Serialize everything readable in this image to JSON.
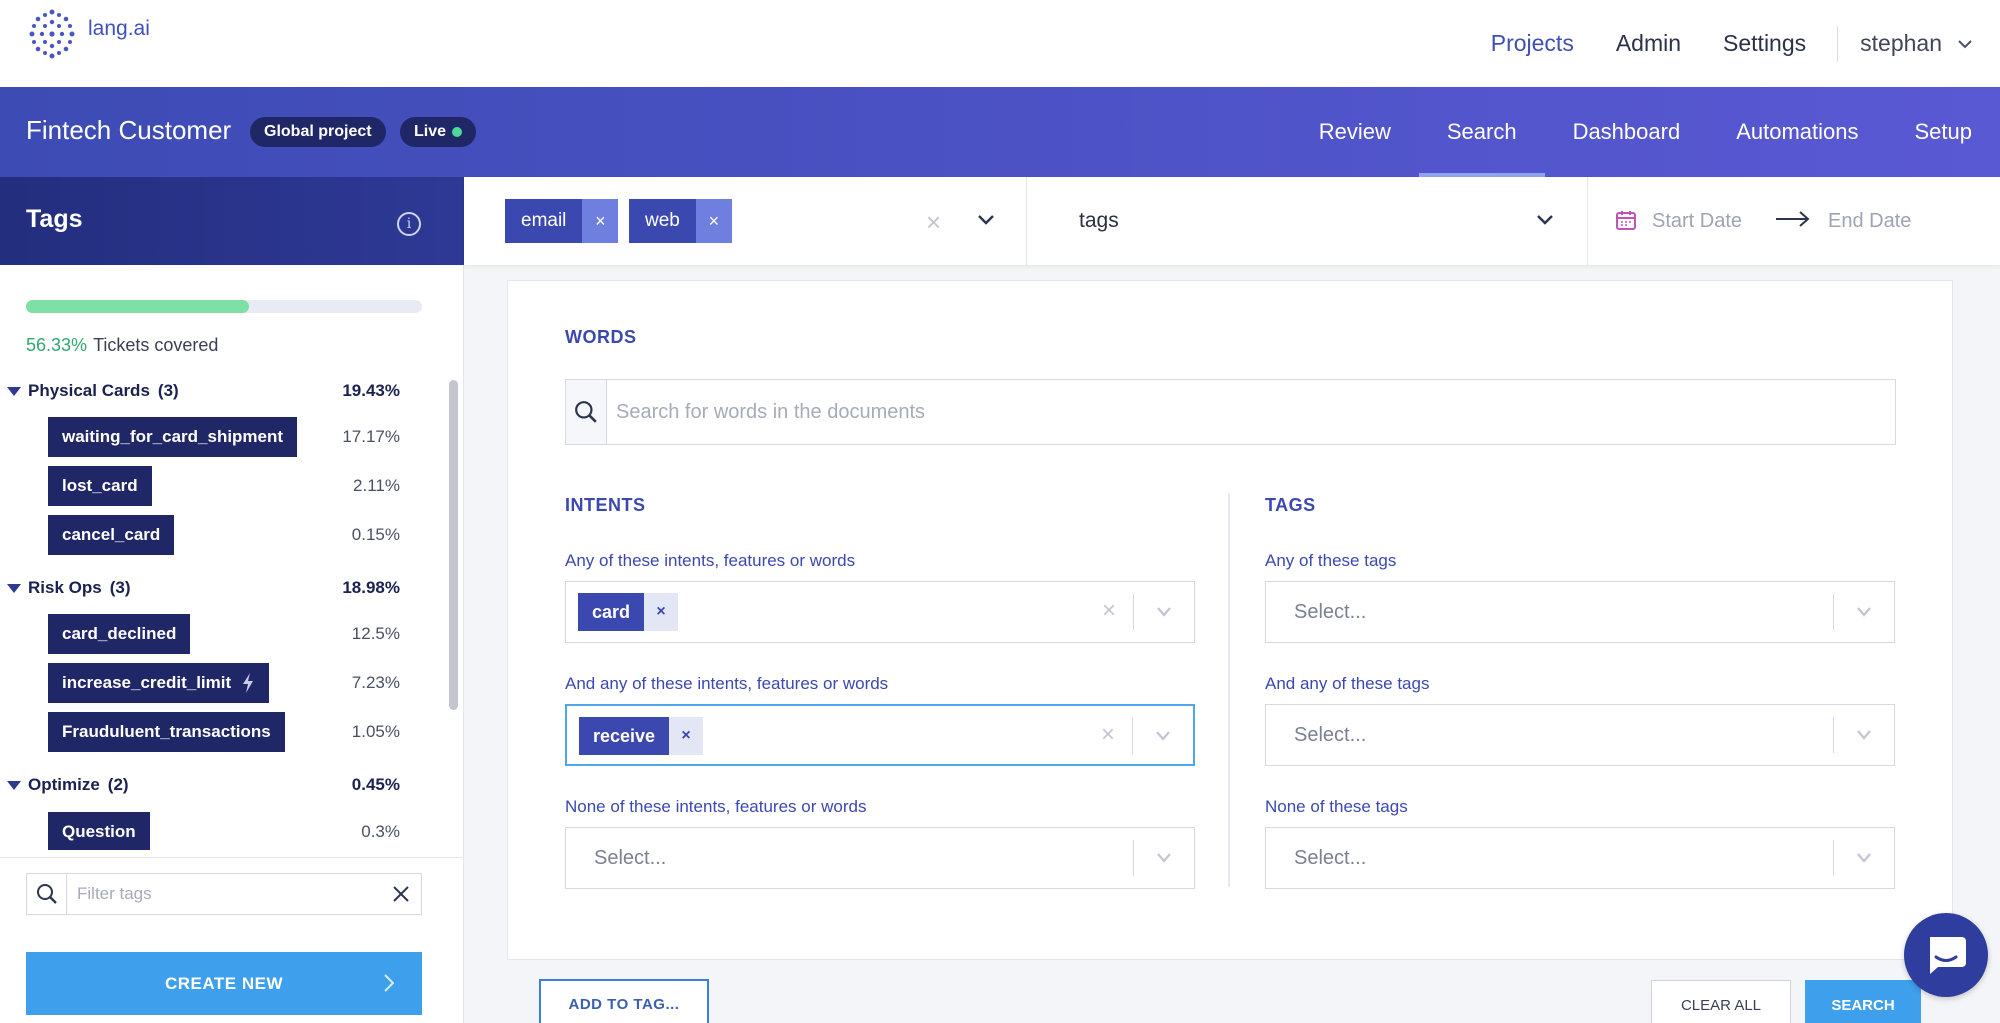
{
  "app": {
    "logo_text": "lang.ai"
  },
  "topnav": {
    "items": [
      "Projects",
      "Admin",
      "Settings"
    ],
    "active": "Projects",
    "user": "stephan"
  },
  "project": {
    "title": "Fintech Customer",
    "badge_global": "Global project",
    "badge_live": "Live",
    "tabs": [
      "Review",
      "Search",
      "Dashboard",
      "Automations",
      "Setup"
    ],
    "active_tab": "Search"
  },
  "sidebar": {
    "title": "Tags",
    "coverage_pct": "56.33%",
    "coverage_label": "Tickets covered",
    "coverage_fraction": 0.5633,
    "groups": [
      {
        "name": "Physical Cards",
        "count": "(3)",
        "pct": "19.43%",
        "tags": [
          {
            "label": "waiting_for_card_shipment",
            "pct": "17.17%"
          },
          {
            "label": "lost_card",
            "pct": "2.11%"
          },
          {
            "label": "cancel_card",
            "pct": "0.15%"
          }
        ]
      },
      {
        "name": "Risk Ops",
        "count": "(3)",
        "pct": "18.98%",
        "tags": [
          {
            "label": "card_declined",
            "pct": "12.5%"
          },
          {
            "label": "increase_credit_limit",
            "pct": "7.23%",
            "icon": "bolt-icon"
          },
          {
            "label": "Frauduluent_transactions",
            "pct": "1.05%"
          }
        ]
      },
      {
        "name": "Optimize",
        "count": "(2)",
        "pct": "0.45%",
        "tags": [
          {
            "label": "Question",
            "pct": "0.3%"
          }
        ]
      }
    ],
    "filter_placeholder": "Filter tags",
    "create_label": "CREATE NEW"
  },
  "filterbar": {
    "sources": [
      "email",
      "web"
    ],
    "tag_value": "tags",
    "start_date": "Start Date",
    "end_date": "End Date"
  },
  "words": {
    "title": "WORDS",
    "placeholder": "Search for words in the documents"
  },
  "intents": {
    "title": "INTENTS",
    "any_label": "Any of these intents, features or words",
    "any_chip": "card",
    "and_label": "And any of these intents, features or words",
    "and_chip": "receive",
    "none_label": "None of these intents, features or words",
    "none_placeholder": "Select..."
  },
  "tags": {
    "title": "TAGS",
    "any_label": "Any of these tags",
    "and_label": "And any of these tags",
    "none_label": "None of these tags",
    "placeholder": "Select..."
  },
  "footer": {
    "add_to_tag": "ADD TO TAG...",
    "clear_all": "CLEAR ALL",
    "search": "SEARCH"
  },
  "colors": {
    "brand": "#3b48b0",
    "header_gradient_start": "#3d4bb4",
    "header_gradient_end": "#5a59d4",
    "accent_blue": "#3ea0ec",
    "progress": "#7fe0a6",
    "tag_chip": "#1f2766"
  }
}
